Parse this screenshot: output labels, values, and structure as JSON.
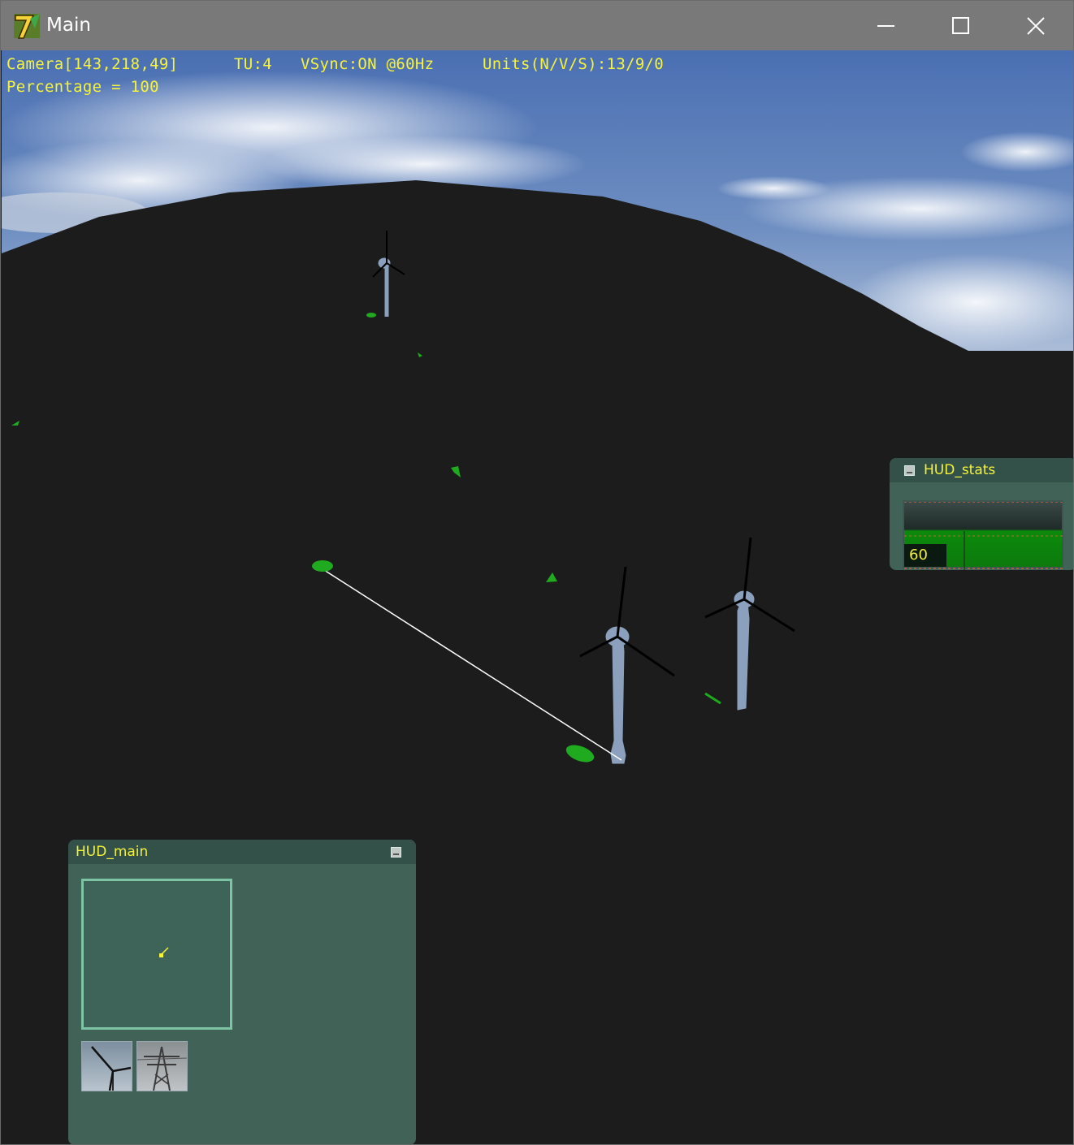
{
  "window": {
    "title": "Main",
    "controls": [
      "minimize-icon",
      "maximize-icon",
      "close-icon"
    ]
  },
  "overlay": {
    "camera": "Camera[143,218,49]",
    "tu": "TU:4",
    "vsync": "VSync:ON @60Hz",
    "units": "Units(N/V/S):13/9/0",
    "percentage": "Percentage = 100"
  },
  "hud_stats": {
    "title": "HUD_stats",
    "value": "60"
  },
  "hud_main": {
    "title": "HUD_main",
    "build_buttons": [
      "wind-turbine-icon",
      "power-pylon-icon"
    ]
  },
  "colors": {
    "overlay_text": "#f7f33a",
    "terrain": "#1c1c1c",
    "unit_green": "#1faa1f",
    "turbine": "#8aa0bd",
    "hud_panel": "#486e62"
  }
}
